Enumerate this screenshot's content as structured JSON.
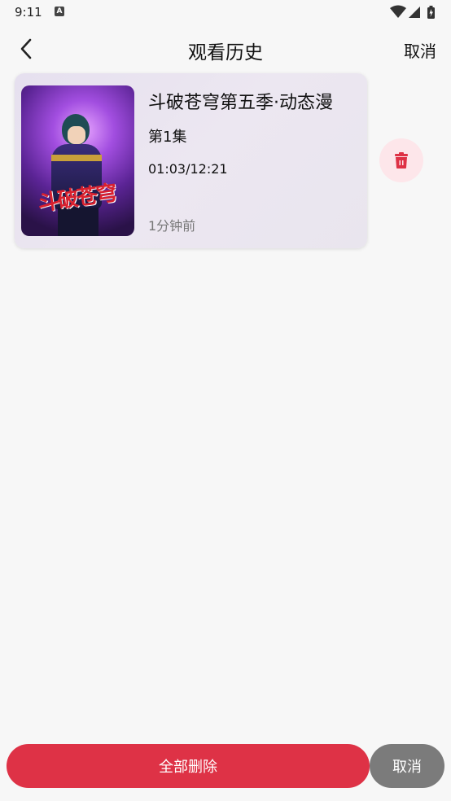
{
  "status_bar": {
    "time": "9:11",
    "notification_icon": "a-letter-icon",
    "indicators": [
      "wifi-icon",
      "signal-icon",
      "battery-charging-icon"
    ]
  },
  "header": {
    "back_icon": "chevron-left-icon",
    "title": "观看历史",
    "cancel_label": "取消"
  },
  "history": [
    {
      "title": "斗破苍穹第五季·动态漫",
      "episode": "第1集",
      "progress": "01:03/12:21",
      "watched_ago": "1分钟前",
      "cover_logo_text": "斗破苍穹",
      "delete_icon": "trash-icon"
    }
  ],
  "bottom_bar": {
    "delete_all_label": "全部删除",
    "cancel_label": "取消"
  },
  "colors": {
    "background": "#f7f7f7",
    "accent_red": "#de3246",
    "delete_bg": "#fde6ea",
    "cancel_gray": "#7b7b7b",
    "card_bg": "#e9e4ef"
  }
}
